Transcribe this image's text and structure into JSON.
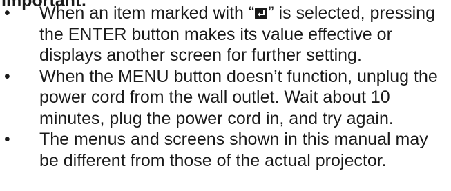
{
  "notice": {
    "heading": "Important:",
    "items": [
      {
        "before_icon": "When an item marked with “",
        "icon": "enter-key-icon",
        "after_icon": "” is selected, pressing the ENTER button makes its value effective or displays another screen for further setting."
      },
      {
        "text": "When the MENU button doesn’t function, unplug the power cord from the wall outlet. Wait about 10 minutes, plug the power cord in, and try again."
      },
      {
        "text": "The menus and screens shown in this manual may be different from those of the actual projector."
      }
    ],
    "bullet_symbol": "•"
  }
}
